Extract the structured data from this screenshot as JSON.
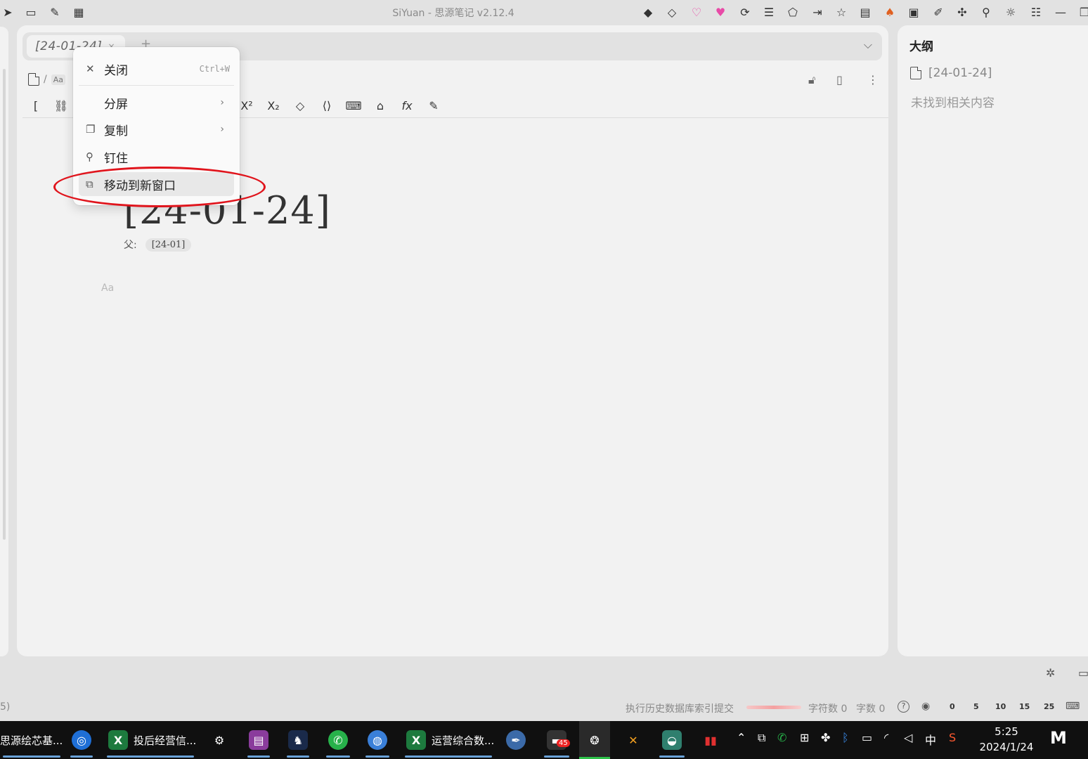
{
  "app": {
    "title": "SiYuan - 思源笔记 v2.12.4",
    "accent_color": "#e0141c"
  },
  "titlebar": {
    "left_icons": [
      "send-icon",
      "bookmark-icon",
      "edit-note-icon",
      "calendar-icon"
    ],
    "right_icons": [
      "diamond-icon",
      "diamond-outline-icon",
      "heart-outline-icon",
      "heart-filled-icon",
      "sync-icon",
      "list-icon",
      "shirt-icon",
      "login-icon",
      "star-icon",
      "book-icon",
      "fox-icon",
      "image-icon",
      "draw-icon",
      "puzzle-icon",
      "search-icon",
      "sun-icon",
      "sliders-icon",
      "minimize-icon",
      "restore-icon"
    ]
  },
  "tabs": {
    "items": [
      {
        "label": "[24-01-24]",
        "close": "×"
      }
    ],
    "add": "+",
    "more": "⌵"
  },
  "breadcrumb": {
    "separator": "/",
    "aa": "Aa"
  },
  "context_menu": {
    "items": [
      {
        "label": "关闭",
        "shortcut": "Ctrl+W",
        "icon": "close-icon"
      },
      {
        "label": "分屏",
        "arrow": "›",
        "icon": ""
      },
      {
        "label": "复制",
        "arrow": "›",
        "icon": "copy-icon"
      },
      {
        "label": "钉住",
        "icon": "pin-icon"
      },
      {
        "label": "移动到新窗口",
        "icon": "open-new-window-icon"
      }
    ]
  },
  "toolbar": {
    "visible_start": "[",
    "tools": [
      "link-icon",
      "superscript-icon",
      "subscript-icon",
      "eraser-icon",
      "code-icon",
      "keyboard-icon",
      "tag-icon",
      "formula-icon",
      "memo-icon"
    ]
  },
  "document": {
    "title": "[24-01-24]",
    "parent_label": "父:",
    "parent_chip": "[24-01]",
    "block_aa": "Aa"
  },
  "outline": {
    "title": "大纲",
    "doc_label": "[24-01-24]",
    "empty_text": "未找到相关内容"
  },
  "statusbar": {
    "left_fragment": "5)",
    "sync_text": "执行历史数据库索引提交",
    "chars": "字符数 0",
    "words": "字数 0",
    "help": "?",
    "zoom_levels": [
      "0",
      "5",
      "10",
      "15",
      "25"
    ]
  },
  "taskbar": {
    "tasks": [
      {
        "label": "思源绘芯基...",
        "icon": ""
      },
      {
        "label": "",
        "icon": "browser-icon"
      },
      {
        "label": "投后经营信...",
        "icon": "X"
      },
      {
        "label": "",
        "icon": "settings-icon"
      },
      {
        "label": "",
        "icon": "archive-icon"
      },
      {
        "label": "",
        "icon": "cat-icon"
      },
      {
        "label": "",
        "icon": "wechat-icon"
      },
      {
        "label": "",
        "icon": "globe-icon"
      },
      {
        "label": "运营综合数...",
        "icon": "X"
      },
      {
        "label": "",
        "icon": "feather-icon"
      },
      {
        "label": "45",
        "icon": "badge-app-icon"
      },
      {
        "label": "",
        "icon": "siyuan-icon"
      },
      {
        "label": "",
        "icon": "xmind-icon"
      },
      {
        "label": "",
        "icon": "bird-icon"
      },
      {
        "label": "",
        "icon": "chart-app-icon"
      }
    ],
    "tray": {
      "ime": "中",
      "time": "5:25",
      "date": "2024/1/24"
    }
  }
}
